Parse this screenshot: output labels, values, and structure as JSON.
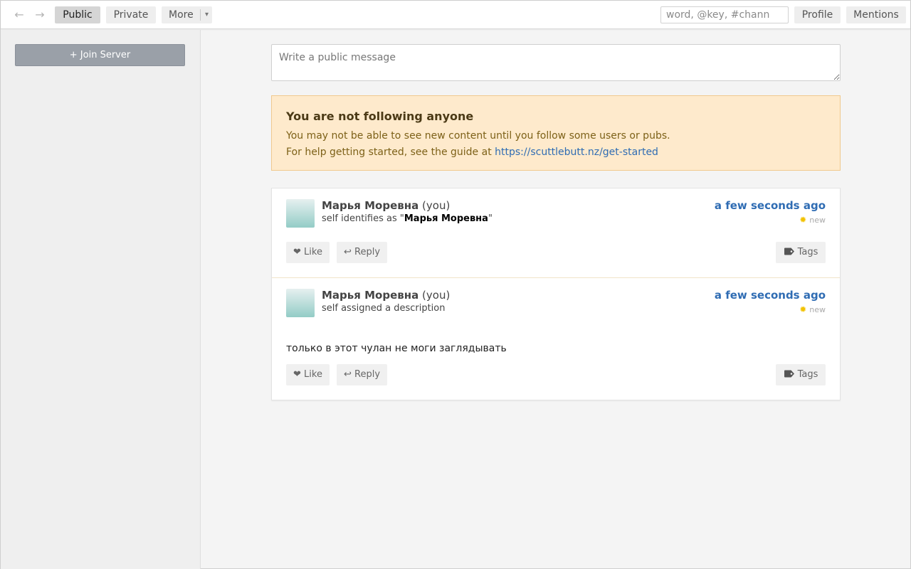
{
  "topbar": {
    "back_icon": "←",
    "forward_icon": "→",
    "tabs": [
      {
        "label": "Public",
        "active": true
      },
      {
        "label": "Private",
        "active": false
      },
      {
        "label": "More",
        "active": false
      }
    ],
    "more_caret": "▾",
    "search_placeholder": "word, @key, #chann",
    "profile_label": "Profile",
    "mentions_label": "Mentions"
  },
  "sidebar": {
    "join_server_label": "+ Join Server"
  },
  "compose": {
    "placeholder": "Write a public message"
  },
  "notice": {
    "title": "You are not following anyone",
    "line1": "You may not be able to see new content until you follow some users or pubs.",
    "line2_prefix": "For help getting started, see the guide at ",
    "link": "https://scuttlebutt.nz/get-started"
  },
  "feed": {
    "messages": [
      {
        "author": "Марья Моревна",
        "you_tag": "(you)",
        "action_prefix": "self identifies as \"",
        "action_name": "Марья Моревна",
        "action_suffix": "\"",
        "timestamp": "a few seconds ago",
        "new_label": "new",
        "like_label": "❤ Like",
        "reply_label": "↩ Reply",
        "tags_label": "Tags"
      },
      {
        "author": "Марья Моревна",
        "you_tag": "(you)",
        "action": "self assigned a description",
        "timestamp": "a few seconds ago",
        "new_label": "new",
        "body": "только в этот чулан не моги заглядывать",
        "like_label": "❤ Like",
        "reply_label": "↩ Reply",
        "tags_label": "Tags"
      }
    ]
  },
  "colors": {
    "accent_link": "#2f6cb3",
    "notice_bg": "#feeacc",
    "new_sun": "#f2c200"
  }
}
